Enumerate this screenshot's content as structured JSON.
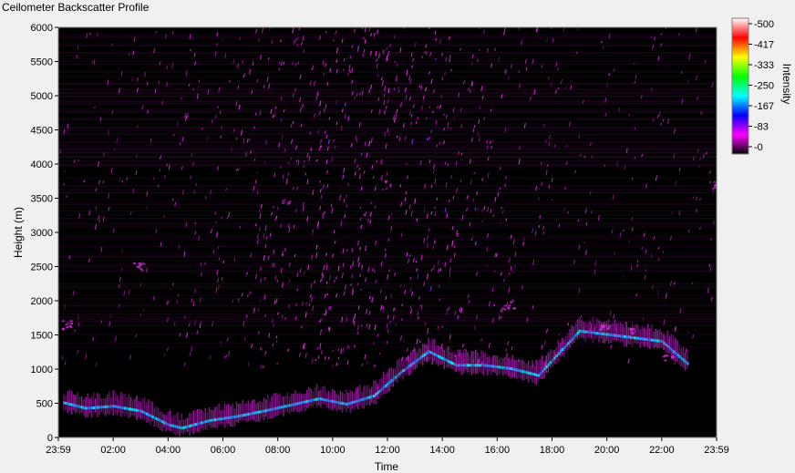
{
  "window": {
    "title": "Ceilometer Backscatter Profile"
  },
  "chart_data": {
    "type": "heatmap",
    "title": "Ceilometer Backscatter Profile",
    "xlabel": "Time",
    "ylabel": "Height (m)",
    "x_ticks": [
      "23:59",
      "02:00",
      "04:00",
      "06:00",
      "08:00",
      "10:00",
      "12:00",
      "14:00",
      "16:00",
      "18:00",
      "20:00",
      "22:00",
      "23:59"
    ],
    "x_tick_hours": [
      0,
      2,
      4,
      6,
      8,
      10,
      12,
      14,
      16,
      18,
      20,
      22,
      24
    ],
    "xlim_hours": [
      0,
      24
    ],
    "ylim": [
      0,
      6000
    ],
    "y_ticks": [
      0,
      500,
      1000,
      1500,
      2000,
      2500,
      3000,
      3500,
      4000,
      4500,
      5000,
      5500,
      6000
    ],
    "colorbar": {
      "label": "Intensity",
      "ticks": [
        500,
        417,
        333,
        250,
        167,
        83,
        0
      ],
      "colors": [
        "#000000",
        "#ff00ff",
        "#0000ff",
        "#00ffff",
        "#00ff00",
        "#ffff00",
        "#ff0000",
        "#ffffff"
      ]
    },
    "cloud_base_layer": [
      {
        "h": 0.2,
        "height": 500
      },
      {
        "h": 1.0,
        "height": 420
      },
      {
        "h": 2.0,
        "height": 450
      },
      {
        "h": 3.0,
        "height": 380
      },
      {
        "h": 4.0,
        "height": 180
      },
      {
        "h": 4.5,
        "height": 130
      },
      {
        "h": 5.5,
        "height": 240
      },
      {
        "h": 6.5,
        "height": 300
      },
      {
        "h": 7.5,
        "height": 380
      },
      {
        "h": 8.5,
        "height": 470
      },
      {
        "h": 9.5,
        "height": 560
      },
      {
        "h": 10.5,
        "height": 480
      },
      {
        "h": 11.5,
        "height": 600
      },
      {
        "h": 12.5,
        "height": 950
      },
      {
        "h": 13.5,
        "height": 1250
      },
      {
        "h": 14.5,
        "height": 1050
      },
      {
        "h": 15.5,
        "height": 1050
      },
      {
        "h": 16.5,
        "height": 1000
      },
      {
        "h": 17.5,
        "height": 900
      },
      {
        "h": 18.3,
        "height": 1250
      },
      {
        "h": 19.0,
        "height": 1550
      },
      {
        "h": 21.0,
        "height": 1450
      },
      {
        "h": 22.0,
        "height": 1400
      },
      {
        "h": 23.0,
        "height": 1050
      }
    ]
  }
}
